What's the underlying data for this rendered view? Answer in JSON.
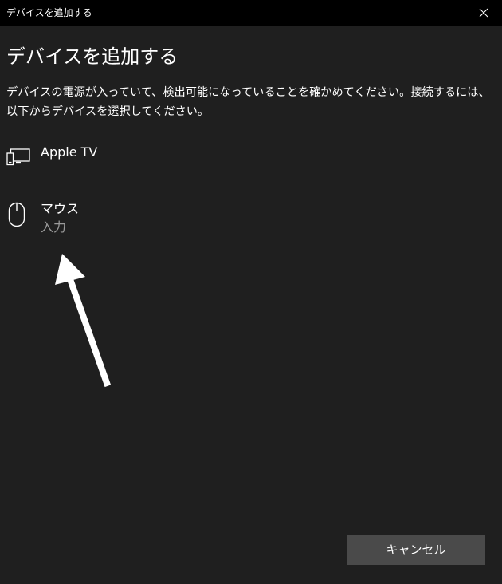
{
  "window": {
    "title": "デバイスを追加する"
  },
  "main": {
    "heading": "デバイスを追加する",
    "description_line1": "デバイスの電源が入っていて、検出可能になっていることを確かめてください。接続するには、",
    "description_line2": "以下からデバイスを選択してください。"
  },
  "devices": [
    {
      "name": "Apple TV",
      "subtitle": "",
      "icon": "display-device-icon"
    },
    {
      "name": "マウス",
      "subtitle": "入力",
      "icon": "mouse-icon"
    }
  ],
  "footer": {
    "cancel_label": "キャンセル"
  },
  "colors": {
    "titlebar": "#000000",
    "background": "#1f1f1f",
    "text": "#ffffff",
    "subtext": "#9a9a9a",
    "button": "#4a4a4a",
    "annotation_arrow": "#ffffff"
  }
}
